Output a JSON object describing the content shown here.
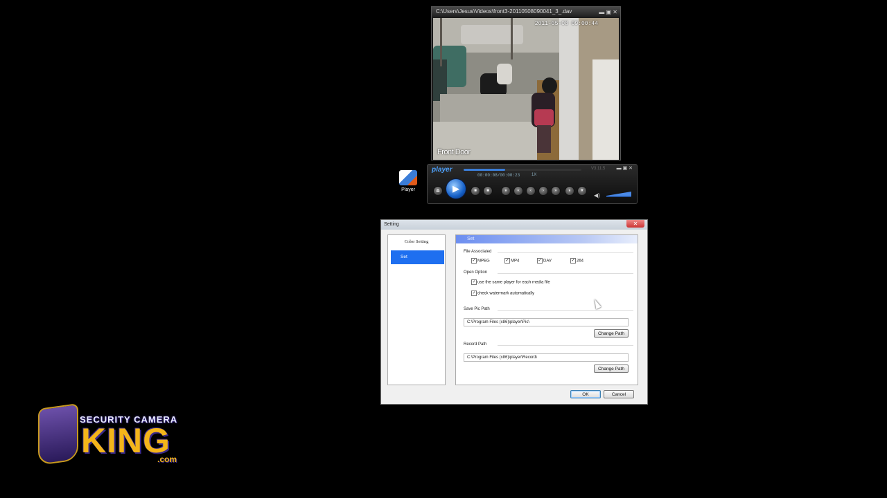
{
  "video_window": {
    "title": "C:\\Users\\Jesus\\Videos\\front3-20110508090041_3_.dav",
    "controls": "▬ ▣ ✕",
    "osd_time": "2011-05-08 09:00:44",
    "osd_label": "Front Door"
  },
  "control_bar": {
    "logo": "player",
    "time": "00:00:08/00:00:23",
    "speed": "1X",
    "version": "V3.11.5",
    "progress_fraction": 0.35,
    "window_controls": "▬ ▣ ✕",
    "icons": [
      "eject-icon",
      "play-icon",
      "stop-icon",
      "step-icon",
      "slow-icon",
      "rewind-icon",
      "prev-frame-icon",
      "next-frame-icon",
      "fast-forward-icon",
      "slower-icon",
      "capture-icon",
      "volume-icon"
    ]
  },
  "desktop_icon": {
    "label": "Player"
  },
  "dialog": {
    "title": "Setting",
    "close": "✕",
    "nav": {
      "color_setting": "Color Setting",
      "set": "Set"
    },
    "panel_header": "Set",
    "file_associated": {
      "title": "File Associated",
      "options": [
        {
          "label": "MPEG",
          "checked": true
        },
        {
          "label": "MP4",
          "checked": true
        },
        {
          "label": "DAV",
          "checked": true
        },
        {
          "label": "264",
          "checked": true
        }
      ]
    },
    "open_option": {
      "title": "Open Option",
      "same_player": "use the same player for each media file",
      "watermark": "check watermark automatically"
    },
    "save_pic": {
      "title": "Save Pic Path",
      "value": "C:\\Program Files (x86)\\player\\Pic\\",
      "button": "Change Path"
    },
    "record": {
      "title": "Record Path",
      "value": "C:\\Program Files (x86)\\player\\Record\\",
      "button": "Change Path"
    },
    "ok": "OK",
    "cancel": "Cancel"
  },
  "logo": {
    "line1": "SECURITY CAMERA",
    "line2": "KING",
    "line3": ".com"
  }
}
